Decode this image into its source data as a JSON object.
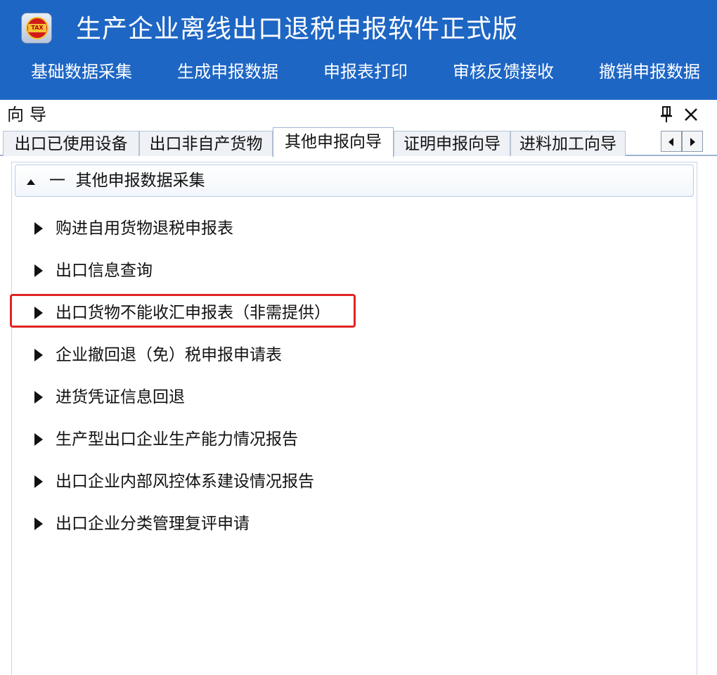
{
  "app": {
    "title": "生产企业离线出口退税申报软件正式版",
    "logo_icon": "tax-logo-icon"
  },
  "menu": {
    "items": [
      {
        "label": "基础数据采集"
      },
      {
        "label": "生成申报数据"
      },
      {
        "label": "申报表打印"
      },
      {
        "label": "审核反馈接收"
      },
      {
        "label": "撤销申报数据"
      }
    ]
  },
  "panel": {
    "title": "向导",
    "pin_icon": "pin-icon",
    "close_icon": "close-icon"
  },
  "tabs": [
    {
      "label": "出口已使用设备"
    },
    {
      "label": "出口非自产货物"
    },
    {
      "label": "其他申报向导",
      "active": true
    },
    {
      "label": "证明申报向导"
    },
    {
      "label": "进料加工向导"
    }
  ],
  "group": {
    "title": "一  其他申报数据采集",
    "expanded": true,
    "items": [
      {
        "label": "购进自用货物退税申报表"
      },
      {
        "label": "出口信息查询"
      },
      {
        "label": "出口货物不能收汇申报表（非需提供）",
        "highlighted": true
      },
      {
        "label": "企业撤回退（免）税申报申请表"
      },
      {
        "label": "进货凭证信息回退"
      },
      {
        "label": "生产型出口企业生产能力情况报告"
      },
      {
        "label": "出口企业内部风控体系建设情况报告"
      },
      {
        "label": "出口企业分类管理复评申请"
      }
    ]
  },
  "colors": {
    "topbar": "#1e66c4",
    "highlight": "#e02424"
  }
}
